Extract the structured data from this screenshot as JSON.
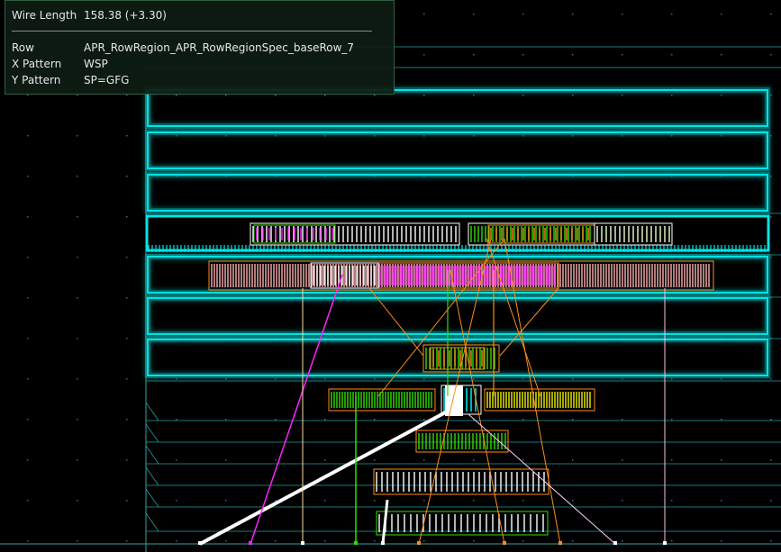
{
  "info_panel": {
    "wire_length_label": "Wire Length",
    "wire_length_value": "158.38 (+3.30)",
    "properties": [
      {
        "label": "Row",
        "value": "APR_RowRegion_APR_RowRegionSpec_baseRow_7"
      },
      {
        "label": "X Pattern",
        "value": "WSP"
      },
      {
        "label": "Y Pattern",
        "value": "SP=GFG"
      }
    ]
  },
  "colors": {
    "background": "#000000",
    "grid_dot": "#2f6f6f",
    "row_outline": "#00e5e5",
    "row_glow": "#00b3b3",
    "track_line": "#1fa0a0",
    "instance_outline": "#ff8c1a",
    "highlight_green": "#33dd00",
    "highlight_yellow": "#f0f000",
    "highlight_magenta": "#ff22ff",
    "highlight_white": "#ffffff",
    "panel_bg": "#0e1c14",
    "panel_border": "#2f5f3f",
    "panel_text": "#e6e6e6"
  }
}
